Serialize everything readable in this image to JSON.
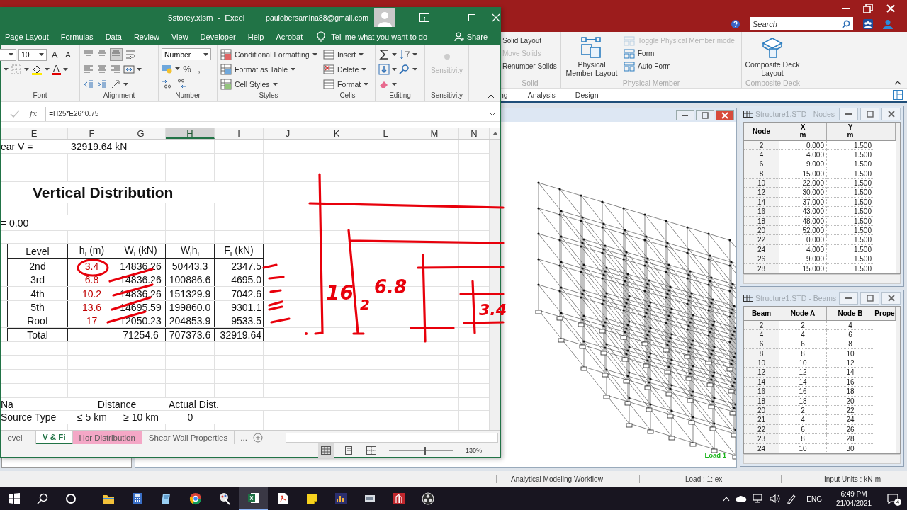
{
  "staad": {
    "search": {
      "placeholder": "Search"
    },
    "ribbon_groups": [
      {
        "label": "Solid",
        "items": [
          {
            "label": "Solid Layout",
            "disabled": false
          },
          {
            "label": "Move Solids",
            "disabled": true
          },
          {
            "label": "Renumber Solids",
            "disabled": false
          }
        ]
      },
      {
        "label": "Physical Member",
        "big_button": "Physical Member Layout",
        "items": [
          {
            "label": "Toggle Physical Member mode",
            "disabled": true
          },
          {
            "label": "Form",
            "disabled": false
          },
          {
            "label": "Auto Form",
            "disabled": false
          }
        ]
      },
      {
        "label": "Composite Deck",
        "big_button": "Composite Deck Layout"
      }
    ],
    "tabs": [
      {
        "label": "ng",
        "selected": false
      },
      {
        "label": "Analysis",
        "selected": false
      },
      {
        "label": "Design",
        "selected": false
      }
    ],
    "view": {
      "load_label": "Load 1"
    },
    "nodes_window": {
      "title": "Structure1.STD - Nodes",
      "columns": [
        {
          "label": "Node"
        },
        {
          "label": "X",
          "unit": "m"
        },
        {
          "label": "Y",
          "unit": "m"
        }
      ],
      "rows": [
        [
          "2",
          "0.000",
          "1.500"
        ],
        [
          "4",
          "4.000",
          "1.500"
        ],
        [
          "6",
          "9.000",
          "1.500"
        ],
        [
          "8",
          "15.000",
          "1.500"
        ],
        [
          "10",
          "22.000",
          "1.500"
        ],
        [
          "12",
          "30.000",
          "1.500"
        ],
        [
          "14",
          "37.000",
          "1.500"
        ],
        [
          "16",
          "43.000",
          "1.500"
        ],
        [
          "18",
          "48.000",
          "1.500"
        ],
        [
          "20",
          "52.000",
          "1.500"
        ],
        [
          "22",
          "0.000",
          "1.500"
        ],
        [
          "24",
          "4.000",
          "1.500"
        ],
        [
          "26",
          "9.000",
          "1.500"
        ],
        [
          "28",
          "15.000",
          "1.500"
        ]
      ]
    },
    "beams_window": {
      "title": "Structure1.STD - Beams",
      "columns": [
        {
          "label": "Beam"
        },
        {
          "label": "Node A"
        },
        {
          "label": "Node B"
        },
        {
          "label": "Prope"
        }
      ],
      "rows": [
        [
          "2",
          "2",
          "4"
        ],
        [
          "4",
          "4",
          "6"
        ],
        [
          "6",
          "6",
          "8"
        ],
        [
          "8",
          "8",
          "10"
        ],
        [
          "10",
          "10",
          "12"
        ],
        [
          "12",
          "12",
          "14"
        ],
        [
          "14",
          "14",
          "16"
        ],
        [
          "16",
          "16",
          "18"
        ],
        [
          "18",
          "18",
          "20"
        ],
        [
          "20",
          "2",
          "22"
        ],
        [
          "21",
          "4",
          "24"
        ],
        [
          "22",
          "6",
          "26"
        ],
        [
          "23",
          "8",
          "28"
        ],
        [
          "24",
          "10",
          "30"
        ]
      ]
    },
    "status_bar": [
      "Analytical Modeling Workflow",
      "Load : 1: ex",
      "Input Units : kN-m"
    ]
  },
  "excel": {
    "title": "5storey.xlsm  -  Excel",
    "account": "paulobersamina88@gmail.com",
    "tabs": [
      "Page Layout",
      "Formulas",
      "Data",
      "Review",
      "View",
      "Developer",
      "Help",
      "Acrobat"
    ],
    "tell_me": "Tell me what you want to do",
    "share": "Share",
    "font": {
      "size": "10",
      "grow": "A",
      "shrink": "A",
      "color_button": "A"
    },
    "number_format": "Number",
    "number_symbols": [
      "%",
      ","
    ],
    "styles": [
      "Conditional Formatting",
      "Format as Table",
      "Cell Styles"
    ],
    "cells": [
      "Insert",
      "Delete",
      "Format"
    ],
    "sensitivity": {
      "label": "Sensitivity",
      "disabled": true
    },
    "group_labels": [
      "Font",
      "Alignment",
      "Number",
      "Styles",
      "Cells",
      "Editing",
      "Sensitivity"
    ],
    "fx": "fx",
    "formula": "=H25*E26^0.75",
    "columns": [
      {
        "label": "E",
        "selected": false
      },
      {
        "label": "F",
        "selected": false
      },
      {
        "label": "G",
        "selected": false
      },
      {
        "label": "H",
        "selected": true
      },
      {
        "label": "I",
        "selected": false
      },
      {
        "label": "J",
        "selected": false
      },
      {
        "label": "K",
        "selected": false
      },
      {
        "label": "L",
        "selected": false
      },
      {
        "label": "M",
        "selected": false
      },
      {
        "label": "N",
        "selected": false
      }
    ],
    "rows": [
      {
        "kind": "plain",
        "cells": {
          "E": {
            "text": "ear V ="
          },
          "F": {
            "text": "32919.64 kN"
          }
        }
      },
      {
        "kind": "blank"
      },
      {
        "kind": "blank"
      },
      {
        "kind": "title",
        "cells": {
          "E": {
            "text": "Vertical Distribution"
          }
        }
      },
      {
        "kind": "blank"
      },
      {
        "kind": "plain",
        "cells": {
          "E": {
            "text": "= 0.00"
          }
        }
      },
      {
        "kind": "blank"
      },
      {
        "kind": "table_head",
        "cells": {
          "E": {
            "text": "Level"
          },
          "F": {
            "text": "h$_{i}$ (m)"
          },
          "G": {
            "text": "W$_{i}$ (kN)"
          },
          "H": {
            "text": "W$_{i}$h$_{i}$"
          },
          "I": {
            "text": "F$_{i}$ (kN)"
          }
        }
      },
      {
        "kind": "table_row",
        "cells": {
          "E": {
            "text": "2nd"
          },
          "F": {
            "text": "3.4",
            "color": "#c00000"
          },
          "G": {
            "text": "14836.26"
          },
          "H": {
            "text": "50443.3"
          },
          "I": {
            "text": "2347.5"
          }
        }
      },
      {
        "kind": "table_row",
        "cells": {
          "E": {
            "text": "3rd"
          },
          "F": {
            "text": "6.8",
            "color": "#c00000"
          },
          "G": {
            "text": "14836.26"
          },
          "H": {
            "text": "100886.6"
          },
          "I": {
            "text": "4695.0"
          }
        }
      },
      {
        "kind": "table_row",
        "cells": {
          "E": {
            "text": "4th"
          },
          "F": {
            "text": "10.2",
            "color": "#c00000"
          },
          "G": {
            "text": "14836.26"
          },
          "H": {
            "text": "151329.9"
          },
          "I": {
            "text": "7042.6"
          }
        }
      },
      {
        "kind": "table_row",
        "cells": {
          "E": {
            "text": "5th"
          },
          "F": {
            "text": "13.6",
            "color": "#c00000"
          },
          "G": {
            "text": "14695.59"
          },
          "H": {
            "text": "199860.0"
          },
          "I": {
            "text": "9301.1"
          }
        }
      },
      {
        "kind": "table_row",
        "cells": {
          "E": {
            "text": "Roof"
          },
          "F": {
            "text": "17",
            "color": "#c00000"
          },
          "G": {
            "text": "12050.23"
          },
          "H": {
            "text": "204853.9"
          },
          "I": {
            "text": "9533.5"
          }
        }
      },
      {
        "kind": "table_total",
        "cells": {
          "E": {
            "text": "Total"
          },
          "G": {
            "text": "71254.6"
          },
          "H": {
            "text": "707373.6"
          },
          "I": {
            "text": "32919.64"
          }
        }
      },
      {
        "kind": "blank"
      },
      {
        "kind": "blank"
      },
      {
        "kind": "blank"
      },
      {
        "kind": "blank"
      },
      {
        "kind": "legend_head",
        "cells": {
          "E": {
            "text": "Na"
          },
          "F": {
            "text": "Distance"
          },
          "H": {
            "text": "Actual Dist."
          }
        }
      },
      {
        "kind": "legend_row",
        "cells": {
          "E": {
            "text": "Source Type"
          },
          "F": {
            "text": "≤ 5 km"
          },
          "G": {
            "text": "≥ 10 km"
          },
          "H": {
            "text": "0"
          }
        }
      }
    ],
    "sheet_tabs": [
      {
        "label": "evel",
        "selected": false
      },
      {
        "label": "V & Fi",
        "selected": true
      },
      {
        "label": "Hor Distribution",
        "selected": false,
        "color": "#f4a7c6"
      },
      {
        "label": "Shear Wall Properties",
        "selected": false
      }
    ],
    "more_tabs": "...",
    "zoom": {
      "level": 0.55,
      "label": "130%"
    }
  },
  "pen_notes": [
    {
      "text": "16"
    },
    {
      "text": "2"
    },
    {
      "text": "6.8"
    },
    {
      "text": "3.4"
    }
  ],
  "taskbar": {
    "apps": [
      {
        "kind": "explorer",
        "selected": false
      },
      {
        "kind": "calculator",
        "selected": false
      },
      {
        "kind": "notes",
        "selected": false
      },
      {
        "kind": "browser",
        "selected": false
      },
      {
        "kind": "paint",
        "selected": false
      },
      {
        "kind": "spreadsheet",
        "selected": true
      },
      {
        "kind": "pdf",
        "selected": false
      },
      {
        "kind": "sticky",
        "selected": false
      },
      {
        "kind": "chart",
        "selected": false
      },
      {
        "kind": "device",
        "selected": false
      },
      {
        "kind": "building",
        "selected": false
      },
      {
        "kind": "recorder",
        "selected": false
      }
    ],
    "language": "ENG",
    "time": "6:49 PM",
    "date": "21/04/2021",
    "notifications": "4"
  }
}
